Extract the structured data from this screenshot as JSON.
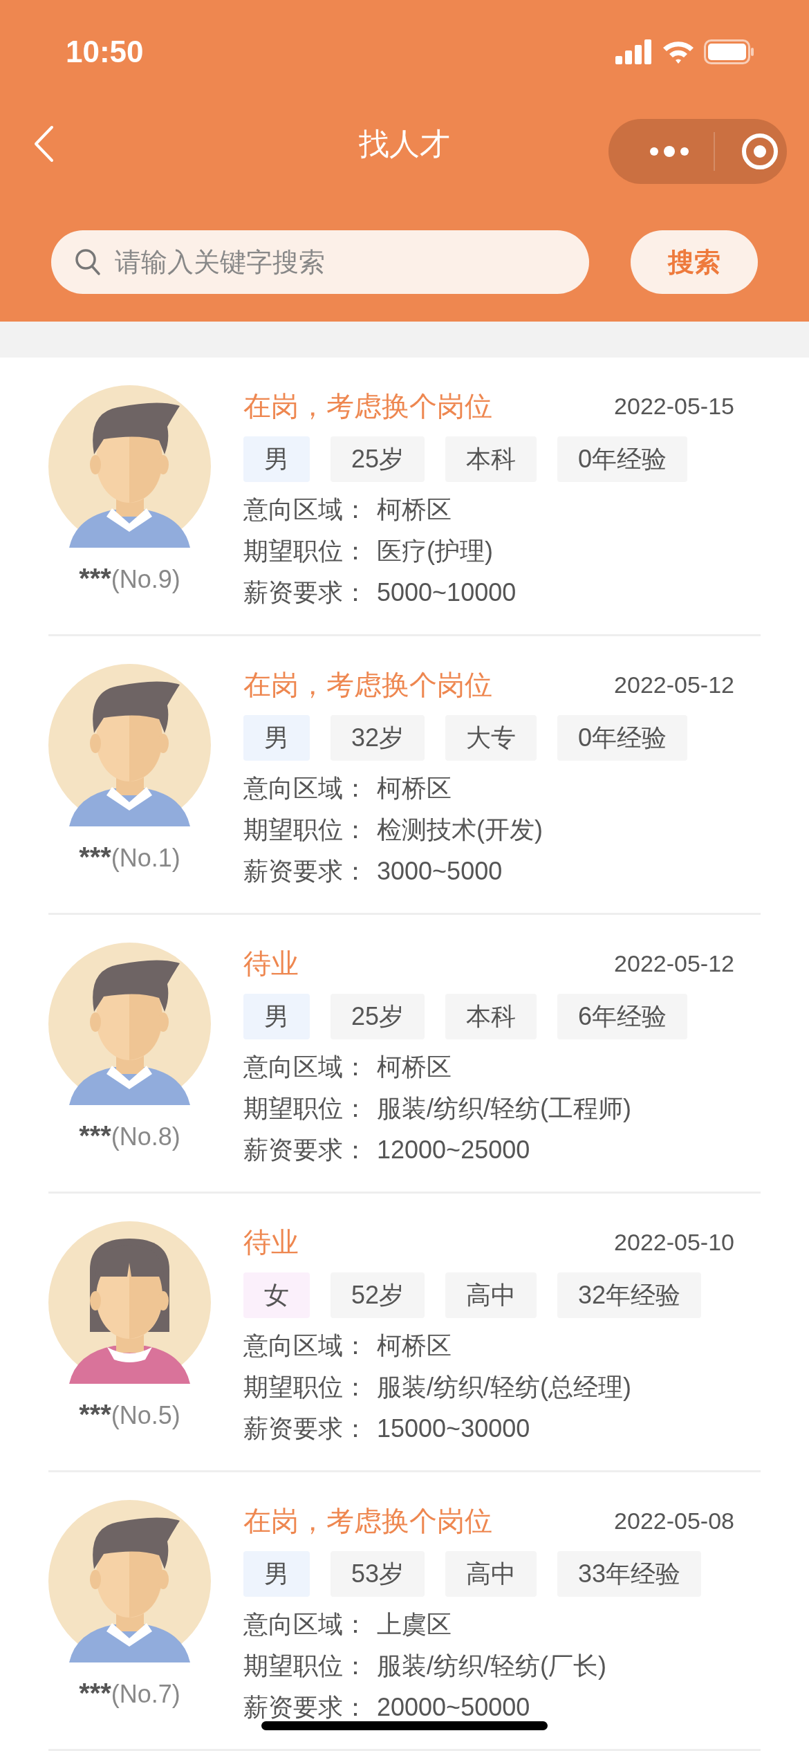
{
  "status_bar": {
    "time": "10:50"
  },
  "nav": {
    "title": "找人才"
  },
  "search": {
    "placeholder": "请输入关键字搜索",
    "button": "搜索"
  },
  "candidates": [
    {
      "status": "在岗，考虑换个岗位",
      "date": "2022-05-15",
      "kind": "male",
      "tags": [
        "男",
        "25岁",
        "本科",
        "0年经验"
      ],
      "fields": [
        {
          "label": "意向区域：",
          "value": "柯桥区"
        },
        {
          "label": "期望职位：",
          "value": "医疗(护理)"
        },
        {
          "label": "薪资要求：",
          "value": "5000~10000"
        }
      ],
      "name": "***",
      "number": "(No.9)"
    },
    {
      "status": "在岗，考虑换个岗位",
      "date": "2022-05-12",
      "kind": "male",
      "tags": [
        "男",
        "32岁",
        "大专",
        "0年经验"
      ],
      "fields": [
        {
          "label": "意向区域：",
          "value": "柯桥区"
        },
        {
          "label": "期望职位：",
          "value": "检测技术(开发)"
        },
        {
          "label": "薪资要求：",
          "value": "3000~5000"
        }
      ],
      "name": "***",
      "number": "(No.1)"
    },
    {
      "status": "待业",
      "date": "2022-05-12",
      "kind": "male",
      "tags": [
        "男",
        "25岁",
        "本科",
        "6年经验"
      ],
      "fields": [
        {
          "label": "意向区域：",
          "value": "柯桥区"
        },
        {
          "label": "期望职位：",
          "value": "服装/纺织/轻纺(工程师)"
        },
        {
          "label": "薪资要求：",
          "value": "12000~25000"
        }
      ],
      "name": "***",
      "number": "(No.8)"
    },
    {
      "status": "待业",
      "date": "2022-05-10",
      "kind": "female",
      "tags": [
        "女",
        "52岁",
        "高中",
        "32年经验"
      ],
      "fields": [
        {
          "label": "意向区域：",
          "value": "柯桥区"
        },
        {
          "label": "期望职位：",
          "value": "服装/纺织/轻纺(总经理)"
        },
        {
          "label": "薪资要求：",
          "value": "15000~30000"
        }
      ],
      "name": "***",
      "number": "(No.5)"
    },
    {
      "status": "在岗，考虑换个岗位",
      "date": "2022-05-08",
      "kind": "male",
      "tags": [
        "男",
        "53岁",
        "高中",
        "33年经验"
      ],
      "fields": [
        {
          "label": "意向区域：",
          "value": "上虞区"
        },
        {
          "label": "期望职位：",
          "value": "服装/纺织/轻纺(厂长)"
        },
        {
          "label": "薪资要求：",
          "value": "20000~50000"
        }
      ],
      "name": "***",
      "number": "(No.7)"
    }
  ]
}
